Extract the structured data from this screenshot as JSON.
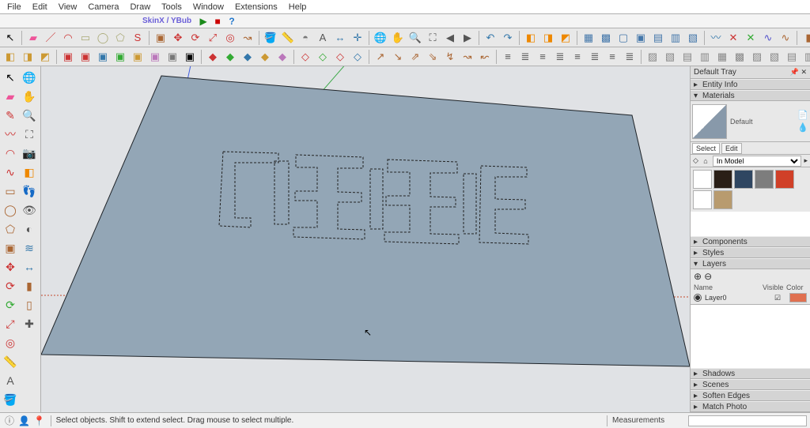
{
  "menu": [
    "File",
    "Edit",
    "View",
    "Camera",
    "Draw",
    "Tools",
    "Window",
    "Extensions",
    "Help"
  ],
  "title": "SkinX / YBub",
  "playbar_icons": [
    "play-icon",
    "stop-red-icon",
    "help-blue-icon"
  ],
  "toolbar1": [
    {
      "name": "select-icon",
      "g": "↖",
      "color": "#000"
    },
    {
      "sep": true
    },
    {
      "name": "eraser-icon",
      "g": "▰",
      "color": "#e59"
    },
    {
      "name": "line-draw-icon",
      "g": "／",
      "color": "#c33"
    },
    {
      "name": "arc-icon",
      "g": "◠",
      "color": "#c33"
    },
    {
      "name": "rect-icon",
      "g": "▭",
      "color": "#aa7"
    },
    {
      "name": "circle-icon",
      "g": "◯",
      "color": "#aa7"
    },
    {
      "name": "polygon-icon",
      "g": "⬠",
      "color": "#aa7"
    },
    {
      "name": "bezier-icon",
      "g": "S",
      "color": "#c33"
    },
    {
      "sep": true
    },
    {
      "name": "pushpull-icon",
      "g": "▣",
      "color": "#a63"
    },
    {
      "name": "move-icon",
      "g": "✥",
      "color": "#c33"
    },
    {
      "name": "rotate-icon",
      "g": "⟳",
      "color": "#c33"
    },
    {
      "name": "scale-icon",
      "g": "⤢",
      "color": "#c33"
    },
    {
      "name": "offset-icon",
      "g": "◎",
      "color": "#c33"
    },
    {
      "name": "followme-icon",
      "g": "↝",
      "color": "#a63"
    },
    {
      "sep": true
    },
    {
      "name": "paint-bucket-icon",
      "g": "🪣",
      "color": "#a63"
    },
    {
      "name": "tape-icon",
      "g": "📏",
      "color": "#c93"
    },
    {
      "name": "protractor-icon",
      "g": "◓",
      "color": "#777"
    },
    {
      "name": "text-icon",
      "g": "A",
      "color": "#555"
    },
    {
      "name": "dimension-icon",
      "g": "↔",
      "color": "#37a"
    },
    {
      "name": "axes-icon",
      "g": "✛",
      "color": "#37a"
    },
    {
      "sep": true
    },
    {
      "name": "orbit-icon",
      "g": "🌐",
      "color": "#4a8"
    },
    {
      "name": "pan-icon",
      "g": "✋",
      "color": "#c93"
    },
    {
      "name": "zoom-icon",
      "g": "🔍",
      "color": "#555"
    },
    {
      "name": "zoom-extents-icon",
      "g": "⛶",
      "color": "#555"
    },
    {
      "name": "prev-view-icon",
      "g": "◀",
      "color": "#555"
    },
    {
      "name": "next-view-icon",
      "g": "▶",
      "color": "#555"
    },
    {
      "sep": true
    },
    {
      "name": "undo-icon",
      "g": "↶",
      "color": "#37a"
    },
    {
      "name": "redo-icon",
      "g": "↷",
      "color": "#37a"
    },
    {
      "sep": true
    },
    {
      "name": "section-icon",
      "g": "◧",
      "color": "#e80"
    },
    {
      "name": "section-fill-icon",
      "g": "◨",
      "color": "#e80"
    },
    {
      "name": "section-cut-icon",
      "g": "◩",
      "color": "#e80"
    },
    {
      "sep": true
    },
    {
      "name": "xray-icon",
      "g": "▦",
      "color": "#47a"
    },
    {
      "name": "backedges-icon",
      "g": "▩",
      "color": "#47a"
    },
    {
      "name": "wire-icon",
      "g": "▢",
      "color": "#47a"
    },
    {
      "name": "hidden-icon",
      "g": "▣",
      "color": "#47a"
    },
    {
      "name": "shaded-icon",
      "g": "▤",
      "color": "#47a"
    },
    {
      "name": "tex-icon",
      "g": "▥",
      "color": "#47a"
    },
    {
      "name": "mono-icon",
      "g": "▧",
      "color": "#47a"
    },
    {
      "sep": true
    },
    {
      "name": "curve-icon",
      "g": "〰",
      "color": "#37a"
    },
    {
      "name": "cut-red-icon",
      "g": "✕",
      "color": "#c33"
    },
    {
      "name": "cut-green-icon",
      "g": "✕",
      "color": "#3a3"
    },
    {
      "name": "weld-icon",
      "g": "∿",
      "color": "#55c"
    },
    {
      "name": "simplify-icon",
      "g": "∿",
      "color": "#a63"
    },
    {
      "sep": true
    },
    {
      "name": "book1-icon",
      "g": "▮",
      "color": "#a63"
    },
    {
      "name": "book2-icon",
      "g": "▮",
      "color": "#3a3"
    },
    {
      "name": "book3-icon",
      "g": "▮",
      "color": "#c33"
    },
    {
      "name": "book4-icon",
      "g": "▮",
      "color": "#37a"
    },
    {
      "name": "book5-icon",
      "g": "▮",
      "color": "#b7b"
    },
    {
      "name": "book6-icon",
      "g": "▮",
      "color": "#777"
    },
    {
      "name": "book7-icon",
      "g": "▮",
      "color": "#e80"
    },
    {
      "sep": true
    },
    {
      "name": "globe-icon",
      "g": "⊕",
      "color": "#000"
    },
    {
      "name": "teapot-icon",
      "g": "🫖",
      "color": "#444"
    },
    {
      "name": "eye-icon",
      "g": "👁",
      "color": "#444"
    },
    {
      "name": "gear-render-icon",
      "g": "⚙",
      "color": "#444"
    },
    {
      "name": "layout-icon",
      "g": "▤",
      "color": "#444"
    },
    {
      "name": "window-icon",
      "g": "▭",
      "color": "#444"
    },
    {
      "name": "windows-icon",
      "g": "▦",
      "color": "#444"
    },
    {
      "name": "grid-icon",
      "g": "⊞",
      "color": "#444"
    },
    {
      "name": "iso-icon",
      "g": "◰",
      "color": "#444"
    },
    {
      "name": "persp-icon",
      "g": "◳",
      "color": "#444"
    },
    {
      "name": "cube1-icon",
      "g": "◩",
      "color": "#444"
    },
    {
      "name": "cube2-icon",
      "g": "◪",
      "color": "#444"
    },
    {
      "name": "tree-icon",
      "g": "⌂",
      "color": "#444"
    },
    {
      "name": "more1-icon",
      "g": "⋯",
      "color": "#444"
    },
    {
      "sep": true
    },
    {
      "name": "sun1-icon",
      "g": "☀",
      "color": "#e80"
    },
    {
      "name": "sun2-icon",
      "g": "◐",
      "color": "#e80"
    },
    {
      "name": "sun3-icon",
      "g": "◑",
      "color": "#e80"
    },
    {
      "name": "sun4-icon",
      "g": "◒",
      "color": "#e80"
    },
    {
      "name": "sun5-icon",
      "g": "✶",
      "color": "#e80"
    },
    {
      "name": "sun6-icon",
      "g": "◍",
      "color": "#e80"
    },
    {
      "name": "sun7-icon",
      "g": "◌",
      "color": "#e80"
    },
    {
      "name": "sun8-icon",
      "g": "✺",
      "color": "#e80"
    }
  ],
  "toolbar2": [
    {
      "name": "box-icon",
      "g": "◧",
      "color": "#c93"
    },
    {
      "name": "box2-icon",
      "g": "◨",
      "color": "#c93"
    },
    {
      "name": "box3-icon",
      "g": "◩",
      "color": "#c93"
    },
    {
      "sep": true
    },
    {
      "name": "plug1-icon",
      "g": "▣",
      "color": "#c33"
    },
    {
      "name": "plug2-icon",
      "g": "▣",
      "color": "#c33"
    },
    {
      "name": "plug3-icon",
      "g": "▣",
      "color": "#37a"
    },
    {
      "name": "plug4-icon",
      "g": "▣",
      "color": "#3a3"
    },
    {
      "name": "plug5-icon",
      "g": "▣",
      "color": "#c93"
    },
    {
      "name": "plug6-icon",
      "g": "▣",
      "color": "#b7b"
    },
    {
      "name": "plug7-icon",
      "g": "▣",
      "color": "#777"
    },
    {
      "name": "plug8-icon",
      "g": "▣",
      "color": "#000"
    },
    {
      "sep": true
    },
    {
      "name": "grp1-icon",
      "g": "◆",
      "color": "#c33"
    },
    {
      "name": "grp2-icon",
      "g": "◆",
      "color": "#3a3"
    },
    {
      "name": "grp3-icon",
      "g": "◆",
      "color": "#37a"
    },
    {
      "name": "grp4-icon",
      "g": "◆",
      "color": "#c93"
    },
    {
      "name": "grp5-icon",
      "g": "◆",
      "color": "#b7b"
    },
    {
      "sep": true
    },
    {
      "name": "grp6-icon",
      "g": "◇",
      "color": "#c33"
    },
    {
      "name": "grp7-icon",
      "g": "◇",
      "color": "#3a3"
    },
    {
      "name": "grp8-icon",
      "g": "◇",
      "color": "#c33"
    },
    {
      "name": "grp9-icon",
      "g": "◇",
      "color": "#37a"
    },
    {
      "sep": true
    },
    {
      "name": "path1-icon",
      "g": "↗",
      "color": "#a63"
    },
    {
      "name": "path2-icon",
      "g": "↘",
      "color": "#a63"
    },
    {
      "name": "path3-icon",
      "g": "⇗",
      "color": "#a63"
    },
    {
      "name": "path4-icon",
      "g": "⇘",
      "color": "#a63"
    },
    {
      "name": "path5-icon",
      "g": "↯",
      "color": "#a63"
    },
    {
      "name": "path6-icon",
      "g": "↝",
      "color": "#a63"
    },
    {
      "name": "path7-icon",
      "g": "↜",
      "color": "#a63"
    },
    {
      "sep": true
    },
    {
      "name": "align1-icon",
      "g": "≡",
      "color": "#555"
    },
    {
      "name": "align2-icon",
      "g": "≣",
      "color": "#555"
    },
    {
      "name": "align3-icon",
      "g": "≡",
      "color": "#555"
    },
    {
      "name": "align4-icon",
      "g": "≣",
      "color": "#555"
    },
    {
      "name": "align5-icon",
      "g": "≡",
      "color": "#555"
    },
    {
      "name": "align6-icon",
      "g": "≣",
      "color": "#555"
    },
    {
      "name": "align7-icon",
      "g": "≡",
      "color": "#555"
    },
    {
      "name": "align8-icon",
      "g": "≣",
      "color": "#555"
    },
    {
      "sep": true
    },
    {
      "name": "hatch1-icon",
      "g": "▨",
      "color": "#888"
    },
    {
      "name": "hatch2-icon",
      "g": "▧",
      "color": "#888"
    },
    {
      "name": "hatch3-icon",
      "g": "▤",
      "color": "#888"
    },
    {
      "name": "hatch4-icon",
      "g": "▥",
      "color": "#888"
    },
    {
      "name": "hatch5-icon",
      "g": "▦",
      "color": "#888"
    },
    {
      "name": "hatch6-icon",
      "g": "▩",
      "color": "#888"
    },
    {
      "name": "hatch7-icon",
      "g": "▨",
      "color": "#888"
    },
    {
      "name": "hatch8-icon",
      "g": "▧",
      "color": "#888"
    },
    {
      "name": "hatch9-icon",
      "g": "▤",
      "color": "#888"
    },
    {
      "name": "hatch10-icon",
      "g": "▥",
      "color": "#888"
    },
    {
      "name": "hatch11-icon",
      "g": "▦",
      "color": "#888"
    },
    {
      "name": "hatch12-icon",
      "g": "▩",
      "color": "#888"
    },
    {
      "sep": true
    },
    {
      "name": "hatch13-icon",
      "g": "▨",
      "color": "#888"
    },
    {
      "name": "hatch14-icon",
      "g": "▧",
      "color": "#888"
    },
    {
      "name": "hatch15-icon",
      "g": "▤",
      "color": "#888"
    },
    {
      "name": "hatch16-icon",
      "g": "▥",
      "color": "#888"
    },
    {
      "name": "hatch17-icon",
      "g": "▦",
      "color": "#888"
    },
    {
      "name": "hatch18-icon",
      "g": "▩",
      "color": "#888"
    }
  ],
  "side_tools": [
    {
      "name": "select-tool-icon",
      "g": "↖",
      "color": "#000"
    },
    {
      "name": "eraser-tool-icon",
      "g": "▰",
      "color": "#e59"
    },
    {
      "name": "pencil-tool-icon",
      "g": "✎",
      "color": "#c33"
    },
    {
      "name": "line-tool-icon",
      "g": "〰",
      "color": "#c33"
    },
    {
      "name": "arc-tool-icon",
      "g": "◠",
      "color": "#c33"
    },
    {
      "name": "freehand-tool-icon",
      "g": "∿",
      "color": "#c33"
    },
    {
      "name": "rect-tool-icon",
      "g": "▭",
      "color": "#a63"
    },
    {
      "name": "circle-tool-icon",
      "g": "◯",
      "color": "#a63"
    },
    {
      "name": "poly-tool-icon",
      "g": "⬠",
      "color": "#a63"
    },
    {
      "name": "pushpull-tool-icon",
      "g": "▣",
      "color": "#a63"
    },
    {
      "name": "move-tool-icon",
      "g": "✥",
      "color": "#c33"
    },
    {
      "name": "rotate-tool-icon",
      "g": "⟳",
      "color": "#c33"
    },
    {
      "name": "follow-tool-icon",
      "g": "⟳",
      "color": "#3a3"
    },
    {
      "name": "scale-tool-icon",
      "g": "⤢",
      "color": "#c33"
    },
    {
      "name": "offset-tool-icon",
      "g": "◎",
      "color": "#c33"
    },
    {
      "name": "tape-tool-icon",
      "g": "📏",
      "color": "#c93"
    },
    {
      "name": "text-tool-icon",
      "g": "A",
      "color": "#555"
    },
    {
      "name": "paint-tool-icon",
      "g": "🪣",
      "color": "#a63"
    },
    {
      "name": "orbit-tool-icon",
      "g": "🌐",
      "color": "#3a3"
    },
    {
      "name": "pan-tool-icon",
      "g": "✋",
      "color": "#c93"
    },
    {
      "name": "zoom-tool-icon",
      "g": "🔍",
      "color": "#555"
    },
    {
      "name": "zoomext-tool-icon",
      "g": "⛶",
      "color": "#555"
    },
    {
      "name": "camera-tool-icon",
      "g": "📷",
      "color": "#555"
    },
    {
      "name": "section-tool-icon",
      "g": "◧",
      "color": "#e80"
    },
    {
      "name": "walk-tool-icon",
      "g": "👣",
      "color": "#c33"
    },
    {
      "name": "look-tool-icon",
      "g": "👁",
      "color": "#555"
    },
    {
      "name": "shadow-tool-icon",
      "g": "◐",
      "color": "#555"
    },
    {
      "name": "fog-tool-icon",
      "g": "≋",
      "color": "#37a"
    },
    {
      "name": "dim-tool-icon",
      "g": "↔",
      "color": "#37a"
    },
    {
      "name": "profile-tool-icon",
      "g": "▮",
      "color": "#a63"
    },
    {
      "name": "profile2-tool-icon",
      "g": "▯",
      "color": "#a63"
    },
    {
      "name": "misc-tool-icon",
      "g": "✚",
      "color": "#555"
    }
  ],
  "tray": {
    "title": "Default Tray",
    "sections": {
      "entity": "Entity Info",
      "materials": "Materials",
      "components": "Components",
      "styles": "Styles",
      "layers": "Layers",
      "shadows": "Shadows",
      "scenes": "Scenes",
      "soften": "Soften Edges",
      "match": "Match Photo"
    },
    "materials": {
      "current": "Default",
      "tabs": [
        "Select",
        "Edit"
      ],
      "active_tab": "Select",
      "model_label": "In Model",
      "swatches": [
        {
          "name": "white-swatch",
          "color": "#ffffff"
        },
        {
          "name": "dark-brown-swatch",
          "color": "#2a1f17"
        },
        {
          "name": "blue-swatch",
          "color": "#2f4661"
        },
        {
          "name": "gray-swatch",
          "color": "#7d7d7d"
        },
        {
          "name": "red-swatch",
          "color": "#d04028"
        },
        {
          "name": "white2-swatch",
          "color": "#ffffff"
        },
        {
          "name": "tan-swatch",
          "color": "#b89b6f"
        }
      ]
    },
    "layers": {
      "cols": [
        "Name",
        "Visible",
        "Color"
      ],
      "rows": [
        {
          "name": "Layer0",
          "visible": true,
          "color": "#e07050"
        }
      ]
    }
  },
  "status": {
    "icons": [
      "info-icon",
      "person-icon",
      "geo-icon"
    ],
    "hint": "Select objects. Shift to extend select. Drag mouse to select multiple.",
    "meas_label": "Measurements"
  }
}
